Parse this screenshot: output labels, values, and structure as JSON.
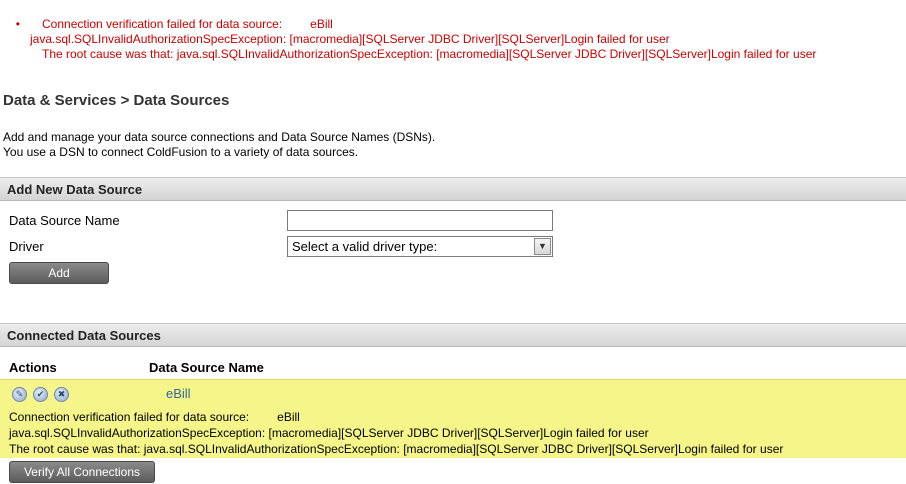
{
  "top_error": {
    "bullet": "•",
    "line1_prefix": "Connection verification failed for data source:",
    "line1_dsn": "eBill",
    "line2": "java.sql.SQLInvalidAuthorizationSpecException: [macromedia][SQLServer JDBC Driver][SQLServer]Login failed for user",
    "line3": "The root cause was that: java.sql.SQLInvalidAuthorizationSpecException: [macromedia][SQLServer JDBC Driver][SQLServer]Login failed for user"
  },
  "page_title": "Data & Services > Data Sources",
  "intro": {
    "line1": "Add and manage your data source connections and Data Source Names (DSNs).",
    "line2": "You use a DSN to connect ColdFusion to a variety of data sources."
  },
  "add_section": {
    "header": "Add New Data Source",
    "name_label": "Data Source Name",
    "name_value": "",
    "driver_label": "Driver",
    "driver_selected": "Select a valid driver type:",
    "add_button": "Add"
  },
  "connected_section": {
    "header": "Connected Data Sources",
    "col_actions": "Actions",
    "col_name": "Data Source Name",
    "rows": [
      {
        "name": "eBill",
        "error_line1_prefix": "Connection verification failed for data source:",
        "error_line1_dsn": "eBill",
        "error_line2": "java.sql.SQLInvalidAuthorizationSpecException: [macromedia][SQLServer JDBC Driver][SQLServer]Login failed for user",
        "error_line3": "The root cause was that: java.sql.SQLInvalidAuthorizationSpecException: [macromedia][SQLServer JDBC Driver][SQLServer]Login failed for user"
      }
    ],
    "verify_button": "Verify All Connections"
  },
  "icons": {
    "edit": "pencil-icon",
    "verify": "check-icon",
    "delete": "x-icon",
    "select_arrow": "chevron-down-icon"
  },
  "colors": {
    "error_text": "#cc0000",
    "row_highlight": "#f5f58a",
    "link": "#336699"
  }
}
